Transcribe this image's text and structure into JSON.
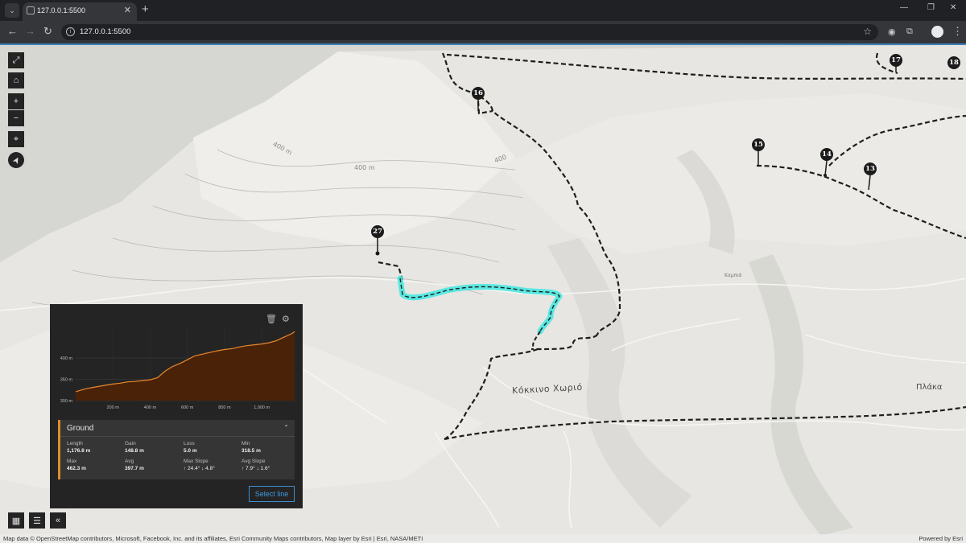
{
  "browser": {
    "tab_title": "127.0.0.1:5500",
    "url": "127.0.0.1:5500"
  },
  "icons": {
    "tab_menu": "chevron-down-icon",
    "close": "close-icon",
    "new_tab": "plus-icon",
    "back": "arrow-left-icon",
    "forward": "arrow-right-icon",
    "reload": "reload-icon",
    "bookmark": "star-icon",
    "extensions": "puzzle-icon",
    "menu": "kebab-icon",
    "fullscreen": "expand-icon",
    "home": "home-icon",
    "zoom_in": "plus-icon",
    "zoom_out": "minus-icon",
    "locate": "locate-icon",
    "compass": "compass-icon",
    "delete": "trash-icon",
    "settings": "gear-icon"
  },
  "map": {
    "waypoints": [
      {
        "id": "27",
        "label": "27"
      },
      {
        "id": "16",
        "label": "16"
      },
      {
        "id": "17",
        "label": "17"
      },
      {
        "id": "18",
        "label": "18"
      },
      {
        "id": "15",
        "label": "15"
      },
      {
        "id": "14",
        "label": "14"
      },
      {
        "id": "13",
        "label": "13"
      }
    ],
    "places": {
      "village": "Κόκκινο Χωριό",
      "plaka": "Πλάκα",
      "kampia": "Καμπιά"
    },
    "contours": {
      "c1": "400 m",
      "c2": "400 m",
      "c3": "400"
    },
    "controls": {
      "fullscreen": "⤢",
      "home": "⌂",
      "zoom_in": "+",
      "zoom_out": "−",
      "locate": "⌖",
      "compass": "➤",
      "qr": "▦",
      "layers": "☰",
      "collapse": "«"
    },
    "attribution": "Map data © OpenStreetMap contributors, Microsoft, Facebook, Inc. and its affiliates, Esri Community Maps contributors, Map layer by Esri | Esri, NASA/METI",
    "powered_by": "Powered by Esri"
  },
  "profile": {
    "select_label": "Select line",
    "stats": {
      "title": "Ground",
      "items": [
        {
          "label": "Length",
          "value": "1,176.8 m"
        },
        {
          "label": "Gain",
          "value": "148.8 m"
        },
        {
          "label": "Loss",
          "value": "5.0 m"
        },
        {
          "label": "Min",
          "value": "318.5 m"
        },
        {
          "label": "Max",
          "value": "462.3 m"
        },
        {
          "label": "Avg",
          "value": "397.7 m"
        },
        {
          "label": "Max Slope",
          "value": "↑ 24.4° ↓ 4.8°"
        },
        {
          "label": "Avg Slope",
          "value": "↑ 7.9° ↓ 1.6°"
        }
      ]
    },
    "colors": {
      "line": "#e8892b",
      "fill": "#4a2208",
      "accent": "#e08d2b",
      "route": "#3ee8e0"
    }
  },
  "chart_data": {
    "type": "area",
    "title": "",
    "xlabel": "",
    "ylabel": "",
    "xlim": [
      0,
      1176.8
    ],
    "ylim": [
      300,
      470
    ],
    "x_ticks": [
      {
        "value": 200,
        "label": "200 m"
      },
      {
        "value": 400,
        "label": "400 m"
      },
      {
        "value": 600,
        "label": "600 m"
      },
      {
        "value": 800,
        "label": "800 m"
      },
      {
        "value": 1000,
        "label": "1,000 m"
      }
    ],
    "y_ticks": [
      {
        "value": 300,
        "label": "300 m"
      },
      {
        "value": 350,
        "label": "350 m"
      },
      {
        "value": 400,
        "label": "400 m"
      }
    ],
    "series": [
      {
        "x": [
          0,
          40,
          80,
          120,
          160,
          200,
          240,
          280,
          320,
          360,
          400,
          440,
          480,
          520,
          560,
          600,
          640,
          680,
          720,
          760,
          800,
          840,
          880,
          920,
          960,
          1000,
          1040,
          1080,
          1120,
          1160,
          1176.8
        ],
        "y": [
          321,
          326,
          330,
          333,
          336,
          339,
          341,
          344,
          345,
          347,
          349,
          354,
          369,
          380,
          387,
          396,
          405,
          409,
          413,
          417,
          420,
          422,
          426,
          429,
          431,
          433,
          436,
          441,
          449,
          457,
          462
        ]
      }
    ]
  }
}
